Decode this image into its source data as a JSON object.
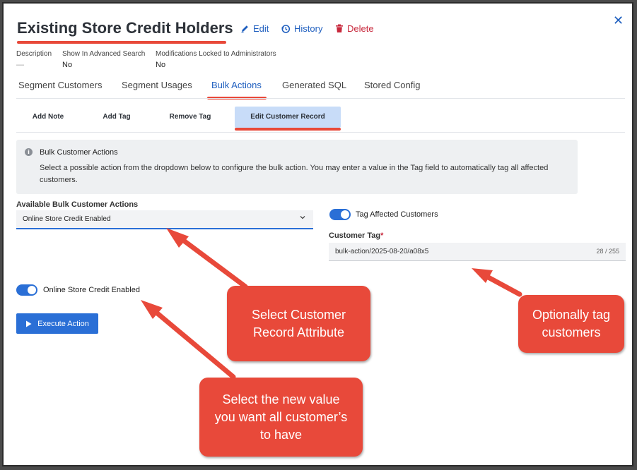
{
  "header": {
    "title": "Existing Store Credit Holders",
    "edit_label": "Edit",
    "history_label": "History",
    "delete_label": "Delete"
  },
  "meta": {
    "description_label": "Description",
    "description_value": "—",
    "search_label": "Show In Advanced Search",
    "search_value": "No",
    "locked_label": "Modifications Locked to Administrators",
    "locked_value": "No"
  },
  "tabs": [
    "Segment Customers",
    "Segment Usages",
    "Bulk Actions",
    "Generated SQL",
    "Stored Config"
  ],
  "active_tab": "Bulk Actions",
  "subtabs": [
    "Add Note",
    "Add Tag",
    "Remove Tag",
    "Edit Customer Record"
  ],
  "active_subtab": "Edit Customer Record",
  "callout": {
    "title": "Bulk Customer Actions",
    "body": "Select a possible action from the dropdown below to configure the bulk action. You may enter a value in the Tag field to automatically tag all affected customers."
  },
  "actions_field": {
    "label": "Available Bulk Customer Actions",
    "value": "Online Store Credit Enabled"
  },
  "tag_toggle": {
    "label": "Tag Affected Customers",
    "on": true
  },
  "customer_tag": {
    "label": "Customer Tag",
    "required_mark": "*",
    "value": "bulk-action/2025-08-20/a08x5",
    "count": "28 / 255"
  },
  "credit_toggle": {
    "label": "Online Store Credit Enabled",
    "on": true
  },
  "execute_button": {
    "label": "Execute Action"
  },
  "annotations": {
    "note1": "Select Customer Record Attribute",
    "note2": "Optionally tag customers",
    "note3": "Select the new value you want all customer’s to have"
  },
  "colors": {
    "accent": "#2a6fd6",
    "annotation": "#e8493a",
    "delete": "#c8283c"
  }
}
